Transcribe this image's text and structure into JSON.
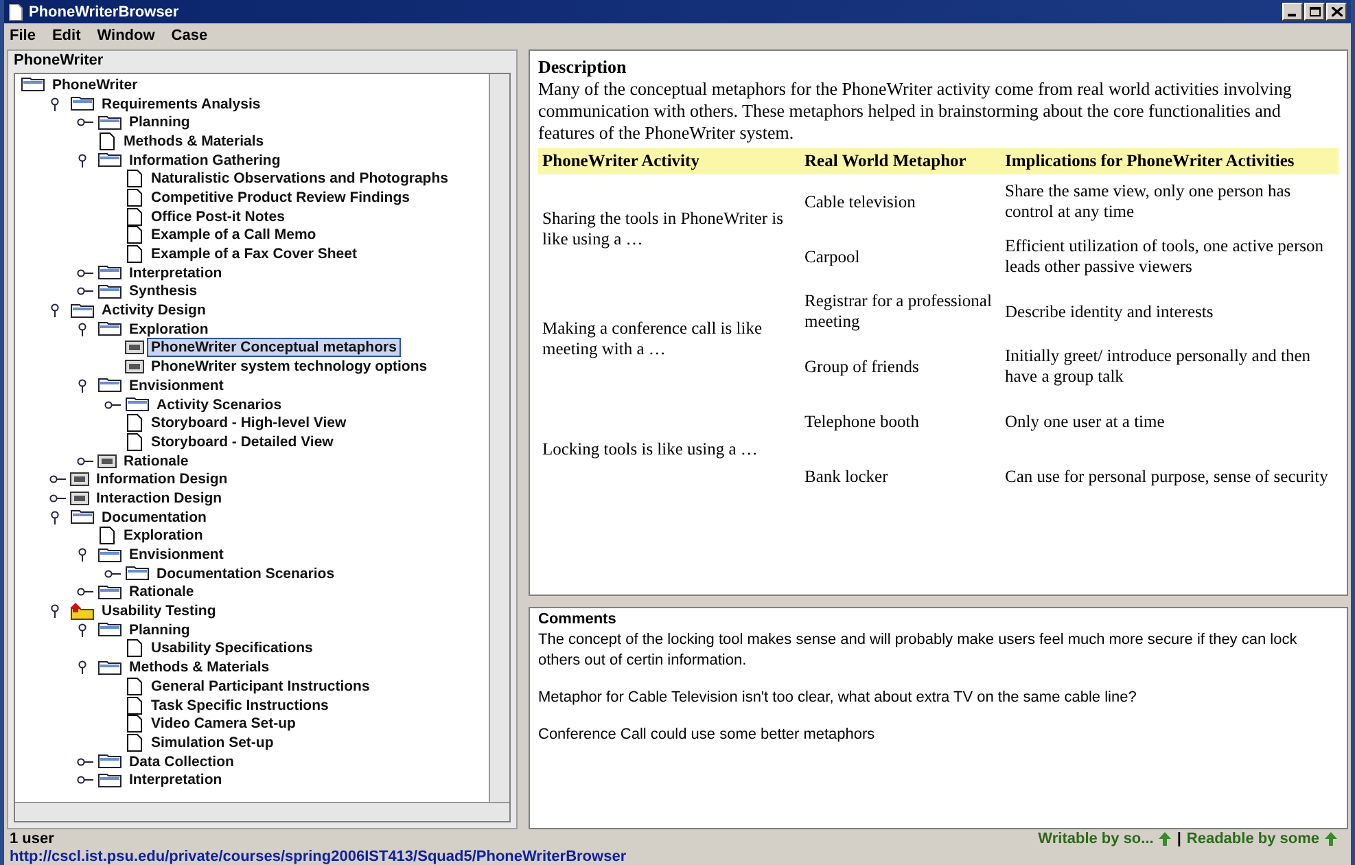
{
  "window": {
    "title": "PhoneWriterBrowser"
  },
  "menu": [
    "File",
    "Edit",
    "Window",
    "Case"
  ],
  "tree_panel": {
    "title": "PhoneWriter",
    "root": {
      "label": "PhoneWriter",
      "kind": "folder",
      "selected": false,
      "children": [
        {
          "label": "Requirements Analysis",
          "kind": "folder",
          "expanded": true,
          "selected": false,
          "children": [
            {
              "label": "Planning",
              "kind": "folder",
              "expanded": false,
              "selected": false
            },
            {
              "label": "Methods & Materials",
              "kind": "doc",
              "selected": false
            },
            {
              "label": "Information Gathering",
              "kind": "folder",
              "expanded": true,
              "selected": false,
              "children": [
                {
                  "label": "Naturalistic Observations and Photographs",
                  "kind": "doc",
                  "selected": false
                },
                {
                  "label": "Competitive Product Review Findings",
                  "kind": "doc",
                  "selected": false
                },
                {
                  "label": "Office Post-it Notes",
                  "kind": "doc",
                  "selected": false
                },
                {
                  "label": "Example of a Call Memo",
                  "kind": "doc",
                  "selected": false
                },
                {
                  "label": "Example of a Fax Cover Sheet",
                  "kind": "doc",
                  "selected": false
                }
              ]
            },
            {
              "label": "Interpretation",
              "kind": "folder",
              "expanded": false,
              "selected": false
            },
            {
              "label": "Synthesis",
              "kind": "folder",
              "expanded": false,
              "selected": false
            }
          ]
        },
        {
          "label": "Activity Design",
          "kind": "folder",
          "expanded": true,
          "selected": false,
          "children": [
            {
              "label": "Exploration",
              "kind": "folder",
              "expanded": true,
              "selected": false,
              "children": [
                {
                  "label": "PhoneWriter Conceptual metaphors",
                  "kind": "card",
                  "selected": true
                },
                {
                  "label": "PhoneWriter system technology options",
                  "kind": "card",
                  "selected": false
                }
              ]
            },
            {
              "label": "Envisionment",
              "kind": "folder",
              "expanded": true,
              "selected": false,
              "children": [
                {
                  "label": "Activity Scenarios",
                  "kind": "folder",
                  "expanded": false,
                  "selected": false
                },
                {
                  "label": "Storyboard - High-level View",
                  "kind": "doc",
                  "selected": false
                },
                {
                  "label": "Storyboard - Detailed View",
                  "kind": "doc",
                  "selected": false
                }
              ]
            },
            {
              "label": "Rationale",
              "kind": "card",
              "expanded": false,
              "selected": false
            }
          ]
        },
        {
          "label": "Information Design",
          "kind": "card",
          "expanded": false,
          "selected": false
        },
        {
          "label": "Interaction Design",
          "kind": "card",
          "expanded": false,
          "selected": false
        },
        {
          "label": "Documentation",
          "kind": "folder",
          "expanded": true,
          "selected": false,
          "children": [
            {
              "label": "Exploration",
              "kind": "doc",
              "selected": false
            },
            {
              "label": "Envisionment",
              "kind": "folder",
              "expanded": true,
              "selected": false,
              "children": [
                {
                  "label": "Documentation Scenarios",
                  "kind": "folder",
                  "expanded": false,
                  "selected": false
                }
              ]
            },
            {
              "label": "Rationale",
              "kind": "folder",
              "expanded": false,
              "selected": false
            }
          ]
        },
        {
          "label": "Usability Testing",
          "kind": "flagged",
          "expanded": true,
          "selected": false,
          "children": [
            {
              "label": "Planning",
              "kind": "folder",
              "expanded": true,
              "selected": false,
              "children": [
                {
                  "label": "Usability Specifications",
                  "kind": "doc",
                  "selected": false
                }
              ]
            },
            {
              "label": "Methods & Materials",
              "kind": "folder",
              "expanded": true,
              "selected": false,
              "children": [
                {
                  "label": "General Participant Instructions",
                  "kind": "doc",
                  "selected": false
                },
                {
                  "label": "Task Specific Instructions",
                  "kind": "doc",
                  "selected": false
                },
                {
                  "label": "Video Camera Set-up",
                  "kind": "doc",
                  "selected": false
                },
                {
                  "label": "Simulation Set-up",
                  "kind": "doc",
                  "selected": false
                }
              ]
            },
            {
              "label": "Data Collection",
              "kind": "folder",
              "expanded": false,
              "selected": false
            },
            {
              "label": "Interpretation",
              "kind": "folder",
              "expanded": false,
              "selected": false
            }
          ]
        }
      ]
    }
  },
  "description": {
    "heading": "Description",
    "text": "Many of the conceptual metaphors for the PhoneWriter activity come from real world activities involving communication with others.  These metaphors helped in brainstorming about the core functionalities and features of the PhoneWriter system.",
    "table": {
      "columns": [
        "PhoneWriter Activity",
        "Real World Metaphor",
        "Implications for PhoneWriter Activities"
      ],
      "groups": [
        {
          "activity": "Sharing the tools in PhoneWriter is like using a …",
          "rows": [
            {
              "metaphor": "Cable television",
              "implication": "Share the same view, only one person has control at any time"
            },
            {
              "metaphor": "Carpool",
              "implication": "Efficient utilization of tools, one active person leads other passive viewers"
            }
          ]
        },
        {
          "activity": "Making a conference call is like meeting with a …",
          "rows": [
            {
              "metaphor": "Registrar for a professional meeting",
              "implication": "Describe identity and interests"
            },
            {
              "metaphor": "Group of friends",
              "implication": "Initially greet/ introduce personally and then have a group talk"
            }
          ]
        },
        {
          "activity": "Locking tools is like using a …",
          "rows": [
            {
              "metaphor": "Telephone booth",
              "implication": "Only one user at a time"
            },
            {
              "metaphor": "Bank locker",
              "implication": "Can use for personal purpose, sense of security"
            }
          ]
        }
      ]
    }
  },
  "comments": {
    "title": "Comments",
    "paragraphs": [
      "The concept of the locking tool makes sense and will probably make users feel much more secure if they can lock others out of certin information.",
      "Metaphor for Cable Television isn't too clear, what about extra TV on the same cable line?",
      "Conference Call could use some better metaphors"
    ]
  },
  "status_bar": {
    "users": "1 user",
    "url": "http://cscl.ist.psu.edu/private/courses/spring2006IST413/Squad5/PhoneWriterBrowser",
    "write_access": "Writable by so...",
    "separator": "|",
    "read_access": "Readable by some"
  }
}
